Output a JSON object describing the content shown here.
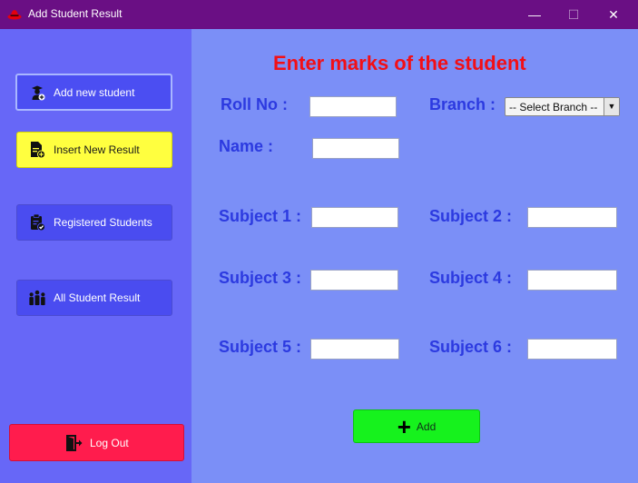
{
  "window": {
    "title": "Add Student Result",
    "min_glyph": "—",
    "max_glyph": "☐",
    "close_glyph": "✕"
  },
  "sidebar": {
    "items": [
      {
        "label": "Add new student",
        "icon": "student-icon"
      },
      {
        "label": "Insert New Result",
        "icon": "document-add-icon"
      },
      {
        "label": "Registered Students",
        "icon": "clipboard-check-icon"
      },
      {
        "label": "All Student Result",
        "icon": "group-icon"
      }
    ],
    "logout_label": "Log Out"
  },
  "form": {
    "heading": "Enter marks of the student",
    "roll_label": "Roll No :",
    "roll_value": "",
    "branch_label": "Branch :",
    "branch_selected": "-- Select Branch --",
    "name_label": "Name :",
    "name_value": "",
    "subjects": [
      {
        "label": "Subject 1 :",
        "value": ""
      },
      {
        "label": "Subject 2 :",
        "value": ""
      },
      {
        "label": "Subject 3 :",
        "value": ""
      },
      {
        "label": "Subject 4 :",
        "value": ""
      },
      {
        "label": "Subject 5 :",
        "value": ""
      },
      {
        "label": "Subject 6 :",
        "value": ""
      }
    ],
    "add_label": "Add"
  },
  "colors": {
    "titlebar": "#6a0f84",
    "sidebar_bg": "#6767f7",
    "main_bg": "#7b8ff7",
    "heading": "#f20f16",
    "label": "#2c3ae0",
    "nav_button": "#4a4cf0",
    "highlight_button": "#ffff3f",
    "logout_button": "#ff1c4d",
    "add_button": "#16f21d"
  }
}
